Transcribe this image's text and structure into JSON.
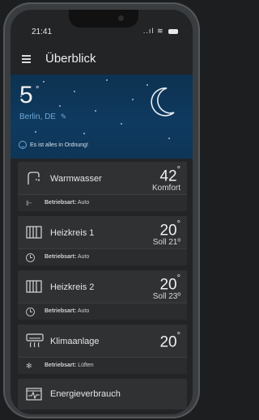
{
  "status": {
    "time": "21:41",
    "signal": "..ıl",
    "wifi": "≋"
  },
  "appbar": {
    "title": "Überblick"
  },
  "weather": {
    "temperature": "5",
    "degree": "°",
    "city": "Berlin, DE",
    "status_message": "Es ist alles in Ordnung!"
  },
  "cards": [
    {
      "label": "Warmwasser",
      "value": "42",
      "unit": "°",
      "note": "Komfort",
      "sub_label": "Betriebsart:",
      "sub_value": " Auto"
    },
    {
      "label": "Heizkreis 1",
      "value": "20",
      "unit": "°",
      "note": "Soll 21º",
      "sub_label": "Betriebsart:",
      "sub_value": " Auto"
    },
    {
      "label": "Heizkreis 2",
      "value": "20",
      "unit": "°",
      "note": "Soll 23º",
      "sub_label": "Betriebsart:",
      "sub_value": " Auto"
    },
    {
      "label": "Klimaanlage",
      "value": "20",
      "unit": "°",
      "sub_label": "Betriebsart:",
      "sub_value": " Lüften"
    },
    {
      "label": "Energieverbrauch"
    }
  ],
  "colors": {
    "accent": "#6fa9d8",
    "weather_bg": "#0f3a60",
    "card_bg": "#2f3133"
  },
  "icons": [
    "menu-icon",
    "pencil-icon",
    "moon-icon",
    "smiley-icon",
    "faucet-icon",
    "radiator-icon",
    "clock-icon",
    "air-conditioner-icon",
    "fan-icon",
    "energy-monitor-icon"
  ]
}
